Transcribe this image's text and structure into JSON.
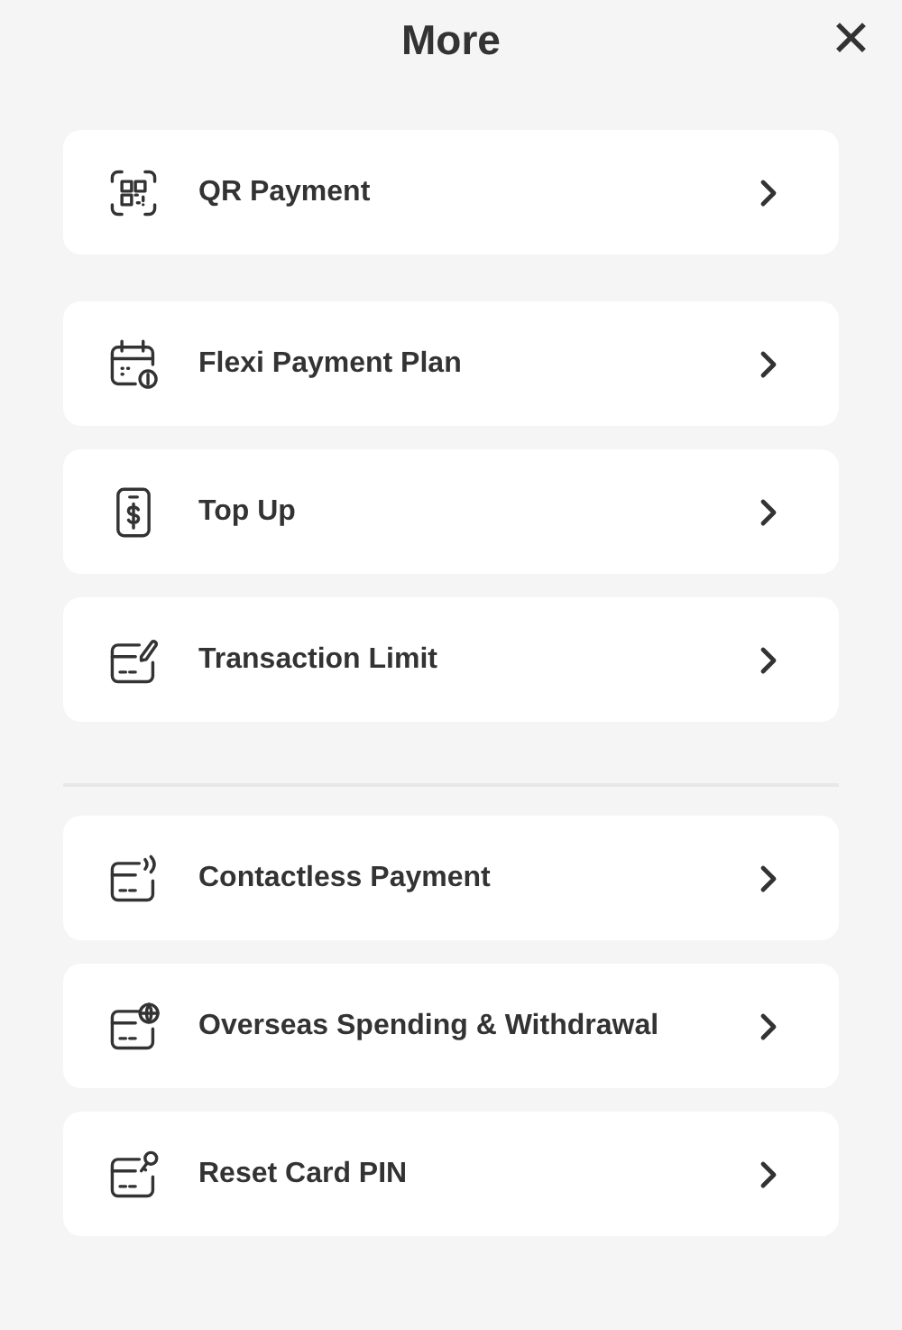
{
  "header": {
    "title": "More",
    "close": "✕"
  },
  "sections": [
    {
      "divider_before": false,
      "items": [
        {
          "kind": "qr",
          "label": "QR Payment"
        }
      ]
    },
    {
      "divider_before": false,
      "items": [
        {
          "kind": "calendar",
          "label": "Flexi Payment Plan"
        },
        {
          "kind": "phone",
          "label": "Top Up"
        },
        {
          "kind": "card-pencil",
          "label": "Transaction Limit"
        }
      ]
    },
    {
      "divider_before": true,
      "items": [
        {
          "kind": "card-wave",
          "label": "Contactless Payment"
        },
        {
          "kind": "card-globe",
          "label": "Overseas Spending & Withdrawal"
        },
        {
          "kind": "card-key",
          "label": "Reset Card PIN"
        }
      ]
    }
  ]
}
